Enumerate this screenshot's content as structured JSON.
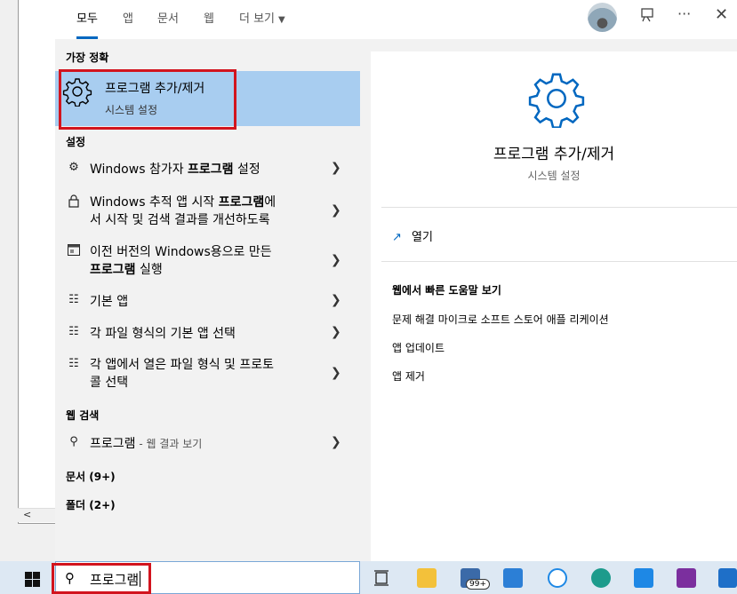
{
  "tabs": [
    {
      "label": "모두"
    },
    {
      "label": "앱"
    },
    {
      "label": "문서"
    },
    {
      "label": "웹"
    },
    {
      "label": "더 보기"
    }
  ],
  "sections": {
    "best_match": "가장 정확",
    "settings": "설정",
    "web_search": "웹 검색",
    "documents": "문서 (9+)",
    "folders": "폴더 (2+)"
  },
  "best_match": {
    "title": "프로그램 추가/제거",
    "subtitle": "시스템 설정"
  },
  "settings_items": [
    {
      "pre": "Windows 참가자 ",
      "bold": "프로그램",
      "post": " 설정",
      "line2": "",
      "icon": "gear-icon"
    },
    {
      "pre": "Windows 추적 앱 시작 ",
      "bold": "프로그램",
      "post": "에",
      "line2": "서 시작 및 검색 결과를 개선하도록",
      "icon": "lock-icon"
    },
    {
      "pre": "이전 버전의 Windows용으로 만든",
      "bold": "",
      "post": "",
      "line2_bold": "프로그램",
      "line2": " 실행",
      "icon": "compat-window-icon"
    },
    {
      "pre": "기본 앱",
      "bold": "",
      "post": "",
      "line2": "",
      "icon": "default-apps-icon"
    },
    {
      "pre": "각 파일 형식의 기본 앱 선택",
      "bold": "",
      "post": "",
      "line2": "",
      "icon": "list-icon"
    },
    {
      "pre": "각 앱에서 열은 파일 형식 및 프로토",
      "bold": "",
      "post": "",
      "line2": "콜 선택",
      "icon": "list-icon"
    }
  ],
  "web_item": {
    "query": "프로그램",
    "suffix": " - 웹 결과 보기"
  },
  "detail": {
    "title": "프로그램 추가/제거",
    "subtitle": "시스템 설정",
    "open_label": "열기",
    "web_help_header": "웹에서 빠른 도움말 보기",
    "web_links": [
      "문제 해결 마이크로 소프트 스토어 애플 리케이션",
      "앱 업데이트",
      "앱 제거"
    ]
  },
  "search": {
    "value": "프로그램"
  },
  "taskbar": {
    "mail_badge": "99+"
  },
  "colors": {
    "accent": "#0067c0",
    "highlight": "#a8cdf0",
    "outline": "#d2141e"
  }
}
